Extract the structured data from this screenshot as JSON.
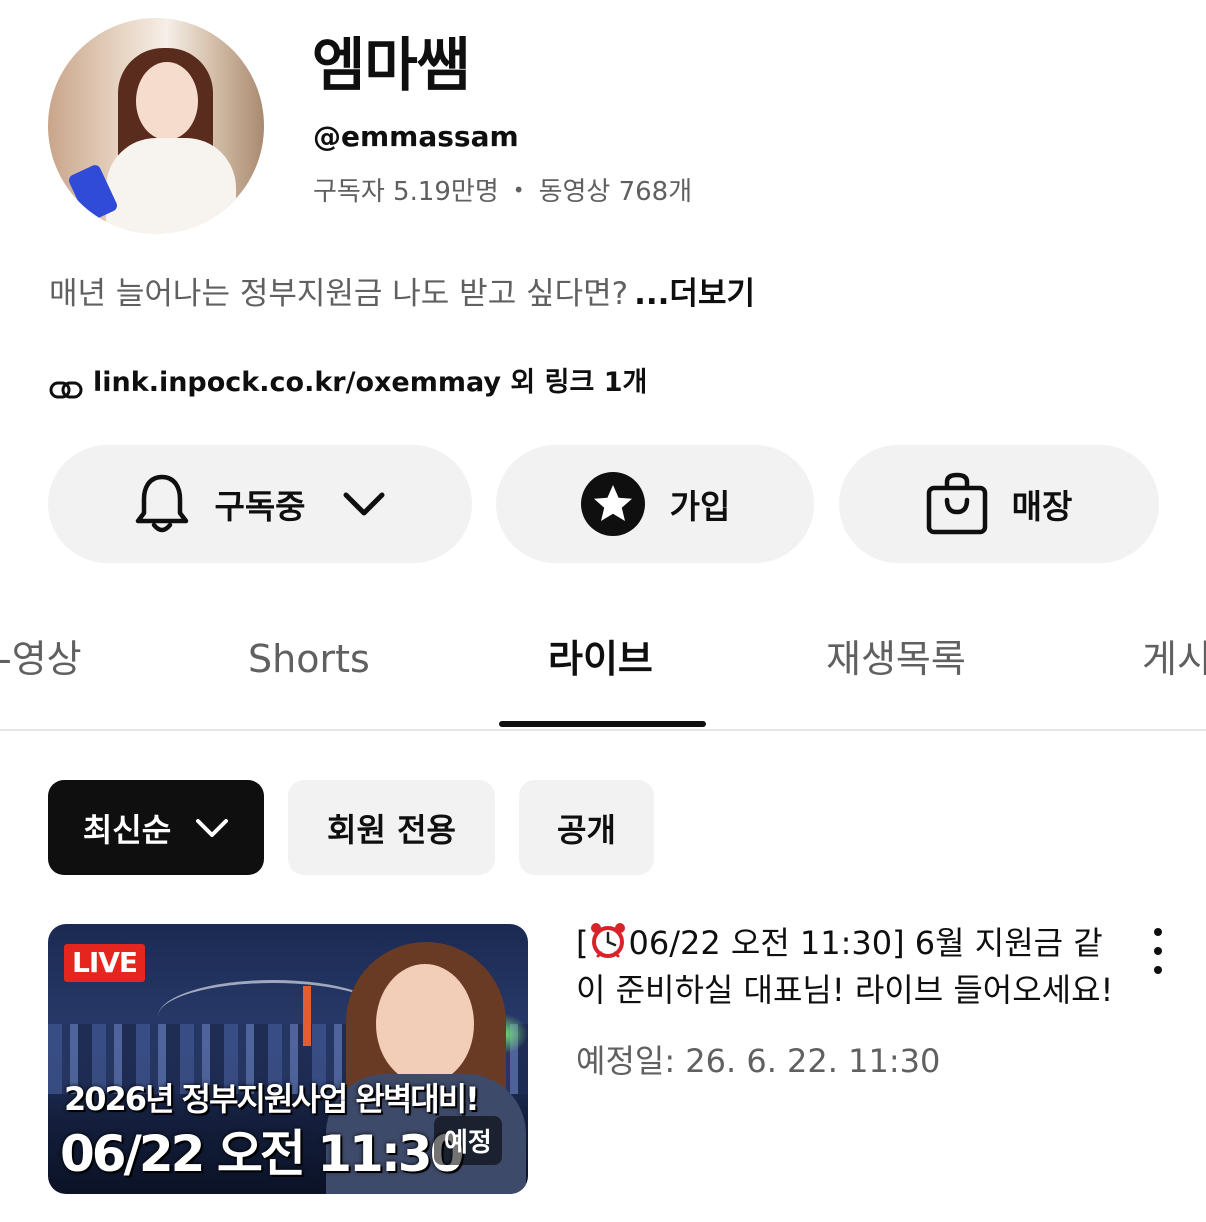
{
  "channel": {
    "name": "엠마쌤",
    "handle": "@emmassam",
    "subscribers": "구독자 5.19만명",
    "dot": "•",
    "videos": "동영상 768개",
    "description": "매년 늘어나는 정부지원금 나도 받고 싶다면?",
    "more_label": "...더보기",
    "link_text": "link.inpock.co.kr/oxemmay",
    "link_extra": " 외 링크 1개"
  },
  "actions": {
    "subscribed_label": "구독중",
    "join_label": "가입",
    "store_label": "매장"
  },
  "tabs": {
    "videos": "-영상",
    "shorts": "Shorts",
    "live": "라이브",
    "playlists": "재생목록",
    "posts": "게시"
  },
  "filters": {
    "sort_label": "최신순",
    "members_only": "회원 전용",
    "public": "공개"
  },
  "video": {
    "thumbnail": {
      "live_badge": "LIVE",
      "line1": "2026년 정부지원사업 완벽대비!",
      "line2": "06/22 오전 11:30",
      "tag": "예정"
    },
    "title_prefix": "[",
    "title_rest": "06/22 오전 11:30] 6월 지원금 같이 준비하실 대표님! 라이브 들어오세요!",
    "scheduled": "예정일: 26. 6. 22. 11:30"
  },
  "icons": {
    "link": "link-icon",
    "bell": "bell-icon",
    "star": "star-badge-icon",
    "bag": "shopping-bag-icon",
    "chevron": "chevron-down-icon",
    "alarm": "alarm-clock-icon",
    "more": "more-vert-icon"
  }
}
